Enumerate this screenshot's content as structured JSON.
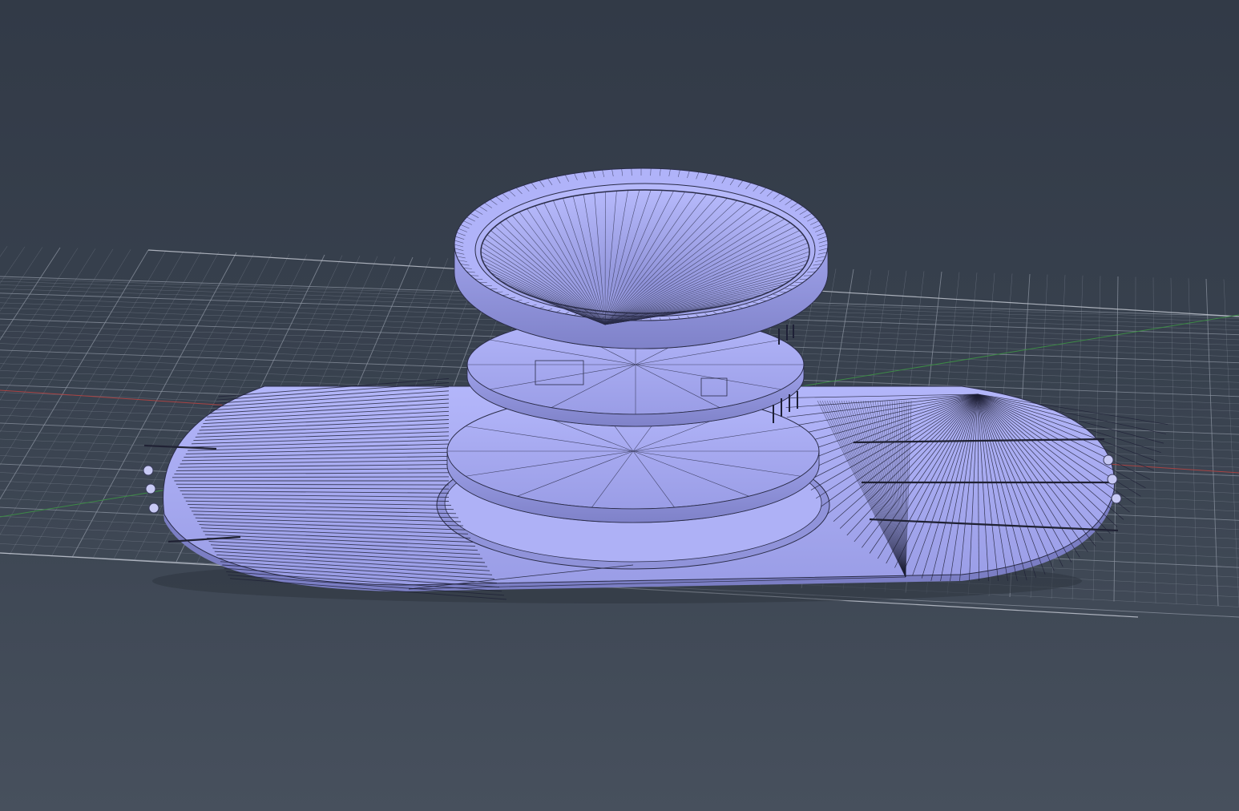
{
  "viewport": {
    "background_top": "#323a47",
    "background_bottom": "#47505d"
  },
  "scene": {
    "grid_color": "#8e96a3",
    "x_axis_color": "#b03a3a",
    "y_axis_color": "#3b8a3b",
    "mesh_fill": "#a8acf4",
    "mesh_fill_dark": "#8d90d8",
    "wire_color": "#2a2c48"
  }
}
